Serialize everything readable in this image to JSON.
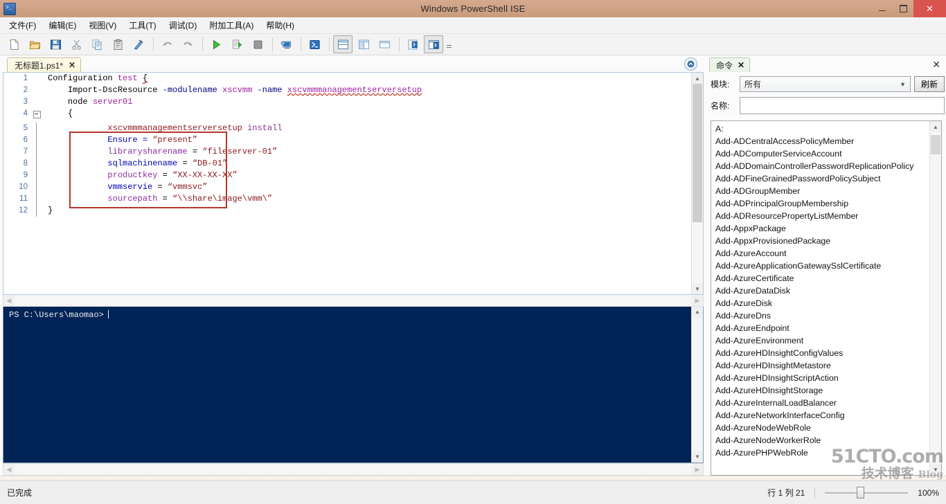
{
  "window": {
    "title": "Windows PowerShell ISE",
    "app_icon": "powershell-icon",
    "minimize": "–",
    "maximize": "❐",
    "close": "✕"
  },
  "menubar": {
    "items": [
      {
        "label": "文件(F)",
        "name": "menu-file"
      },
      {
        "label": "编辑(E)",
        "name": "menu-edit"
      },
      {
        "label": "视图(V)",
        "name": "menu-view"
      },
      {
        "label": "工具(T)",
        "name": "menu-tools"
      },
      {
        "label": "调试(D)",
        "name": "menu-debug"
      },
      {
        "label": "附加工具(A)",
        "name": "menu-addons"
      },
      {
        "label": "帮助(H)",
        "name": "menu-help"
      }
    ]
  },
  "toolbar": {
    "buttons": [
      "new-script-icon",
      "open-script-icon",
      "save-icon",
      "cut-icon",
      "copy-icon",
      "paste-icon",
      "clear-console-icon",
      "undo-icon",
      "redo-icon",
      "run-script-icon",
      "run-selection-icon",
      "stop-operation-icon",
      "new-remote-session-icon",
      "start-powershell-icon",
      "show-script-pane-top-icon",
      "show-script-pane-right-icon",
      "show-script-pane-maximized-icon",
      "show-command-pane-icon",
      "show-command-addon-icon"
    ],
    "overflow": "toolbar-overflow-icon"
  },
  "editor": {
    "tab": {
      "label": "无标题1.ps1*",
      "close": "✕"
    },
    "collapse_button": "collapse-panel-icon",
    "lines": [
      {
        "n": "1",
        "indent": 0,
        "tokens": [
          {
            "t": "Configuration ",
            "c": "plain"
          },
          {
            "t": "test",
            "c": "kw-mag"
          },
          {
            "t": " ",
            "c": "plain"
          },
          {
            "t": "{",
            "c": "squiggle"
          }
        ]
      },
      {
        "n": "2",
        "indent": 1,
        "tokens": [
          {
            "t": "Import-DscResource ",
            "c": "plain"
          },
          {
            "t": "-modulename",
            "c": "kw-dark"
          },
          {
            "t": " ",
            "c": "plain"
          },
          {
            "t": "xscvmm",
            "c": "kw-mag"
          },
          {
            "t": " ",
            "c": "plain"
          },
          {
            "t": "-name",
            "c": "kw-dark"
          },
          {
            "t": " ",
            "c": "plain"
          },
          {
            "t": "xscvmmmanagementserversetup",
            "c": "kw-mag squiggle"
          }
        ]
      },
      {
        "n": "3",
        "indent": 1,
        "tokens": [
          {
            "t": "node ",
            "c": "plain"
          },
          {
            "t": "server01",
            "c": "kw-mag"
          }
        ]
      },
      {
        "n": "4",
        "indent": 1,
        "fold": true,
        "tokens": [
          {
            "t": "{",
            "c": "plain"
          }
        ]
      },
      {
        "n": "5",
        "indent": 3,
        "tokens": [
          {
            "t": "xscvmmmanagementserversetup ",
            "c": "kw-str"
          },
          {
            "t": "install",
            "c": "kw-purple"
          }
        ]
      },
      {
        "n": "6",
        "indent": 3,
        "tokens": [
          {
            "t": "Ensure = ",
            "c": "kw-blue"
          },
          {
            "t": "“present”",
            "c": "kw-str"
          }
        ]
      },
      {
        "n": "7",
        "indent": 3,
        "tokens": [
          {
            "t": "librarysharename",
            "c": "kw-purple"
          },
          {
            "t": " = ",
            "c": "plain"
          },
          {
            "t": "“fileserver-01”",
            "c": "kw-str"
          }
        ]
      },
      {
        "n": "8",
        "indent": 3,
        "tokens": [
          {
            "t": "sqlmachinename",
            "c": "kw-blue"
          },
          {
            "t": " = ",
            "c": "plain"
          },
          {
            "t": "“DB-01”",
            "c": "kw-str"
          }
        ]
      },
      {
        "n": "9",
        "indent": 3,
        "tokens": [
          {
            "t": "productkey",
            "c": "kw-purple"
          },
          {
            "t": " = ",
            "c": "plain"
          },
          {
            "t": "“XX-XX-XX-XX”",
            "c": "kw-str"
          }
        ]
      },
      {
        "n": "10",
        "indent": 3,
        "tokens": [
          {
            "t": "vmmservie",
            "c": "kw-blue"
          },
          {
            "t": " = ",
            "c": "plain"
          },
          {
            "t": "“vmmsvc”",
            "c": "kw-str"
          }
        ]
      },
      {
        "n": "11",
        "indent": 3,
        "tokens": [
          {
            "t": "sourcepath",
            "c": "kw-purple"
          },
          {
            "t": " = ",
            "c": "plain"
          },
          {
            "t": "“\\\\share\\image\\vmm\\”",
            "c": "kw-str"
          }
        ]
      },
      {
        "n": "12",
        "indent": 0,
        "tokens": [
          {
            "t": "}",
            "c": "plain"
          }
        ]
      }
    ],
    "highlight_note": "red-annotation-box"
  },
  "console": {
    "prompt": "PS C:\\Users\\maomao>"
  },
  "command_pane": {
    "tab": {
      "label": "命令",
      "close": "✕"
    },
    "pane_close": "✕",
    "module_label": "模块:",
    "module_value": "所有",
    "refresh_label": "刷新",
    "name_label": "名称:",
    "name_value": "",
    "name_placeholder": "",
    "commands": [
      "A:",
      "Add-ADCentralAccessPolicyMember",
      "Add-ADComputerServiceAccount",
      "Add-ADDomainControllerPasswordReplicationPolicy",
      "Add-ADFineGrainedPasswordPolicySubject",
      "Add-ADGroupMember",
      "Add-ADPrincipalGroupMembership",
      "Add-ADResourcePropertyListMember",
      "Add-AppxPackage",
      "Add-AppxProvisionedPackage",
      "Add-AzureAccount",
      "Add-AzureApplicationGatewaySslCertificate",
      "Add-AzureCertificate",
      "Add-AzureDataDisk",
      "Add-AzureDisk",
      "Add-AzureDns",
      "Add-AzureEndpoint",
      "Add-AzureEnvironment",
      "Add-AzureHDInsightConfigValues",
      "Add-AzureHDInsightMetastore",
      "Add-AzureHDInsightScriptAction",
      "Add-AzureHDInsightStorage",
      "Add-AzureInternalLoadBalancer",
      "Add-AzureNetworkInterfaceConfig",
      "Add-AzureNodeWebRole",
      "Add-AzureNodeWorkerRole",
      "Add-AzurePHPWebRole"
    ]
  },
  "statusbar": {
    "status": "已完成",
    "position": "行 1  列 21",
    "zoom": "100%"
  },
  "watermark": {
    "main": "51CTO.com",
    "cn": "技术博客",
    "blog": "Blog"
  },
  "colors": {
    "titlebar": "#cfa183",
    "close_button": "#d9534f",
    "console_bg": "#012456",
    "annotation": "#b5342a",
    "linenumber": "#4a6fa5"
  }
}
